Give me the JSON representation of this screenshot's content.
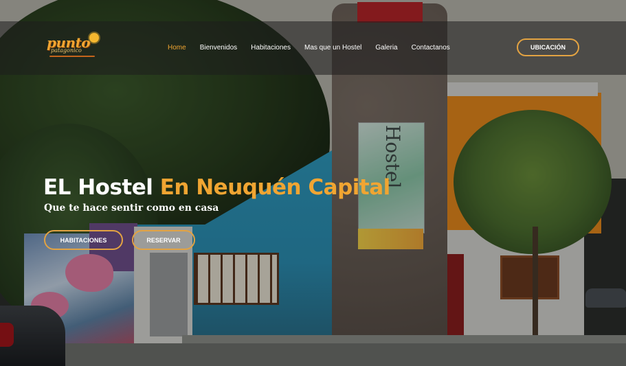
{
  "logo": {
    "name": "punto",
    "subtitle": "patagonico"
  },
  "nav": {
    "items": [
      {
        "label": "Home",
        "active": true
      },
      {
        "label": "Bienvenidos",
        "active": false
      },
      {
        "label": "Habitaciones",
        "active": false
      },
      {
        "label": "Mas que un Hostel",
        "active": false
      },
      {
        "label": "Galeria",
        "active": false
      },
      {
        "label": "Contactanos",
        "active": false
      }
    ]
  },
  "header": {
    "cta_label": "UBICACIÓN"
  },
  "hero": {
    "title_white": "EL Hostel",
    "title_orange": "En Neuquén Capital",
    "subtitle": "Que te hace sentir como en casa",
    "btn_rooms": "HABITACIONES",
    "btn_book": "RESERVAR"
  },
  "scene": {
    "sign_text": "Hostel"
  },
  "colors": {
    "accent": "#f0a532",
    "button_border": "#e3a342",
    "header_bg": "rgba(30,30,30,0.55)"
  }
}
